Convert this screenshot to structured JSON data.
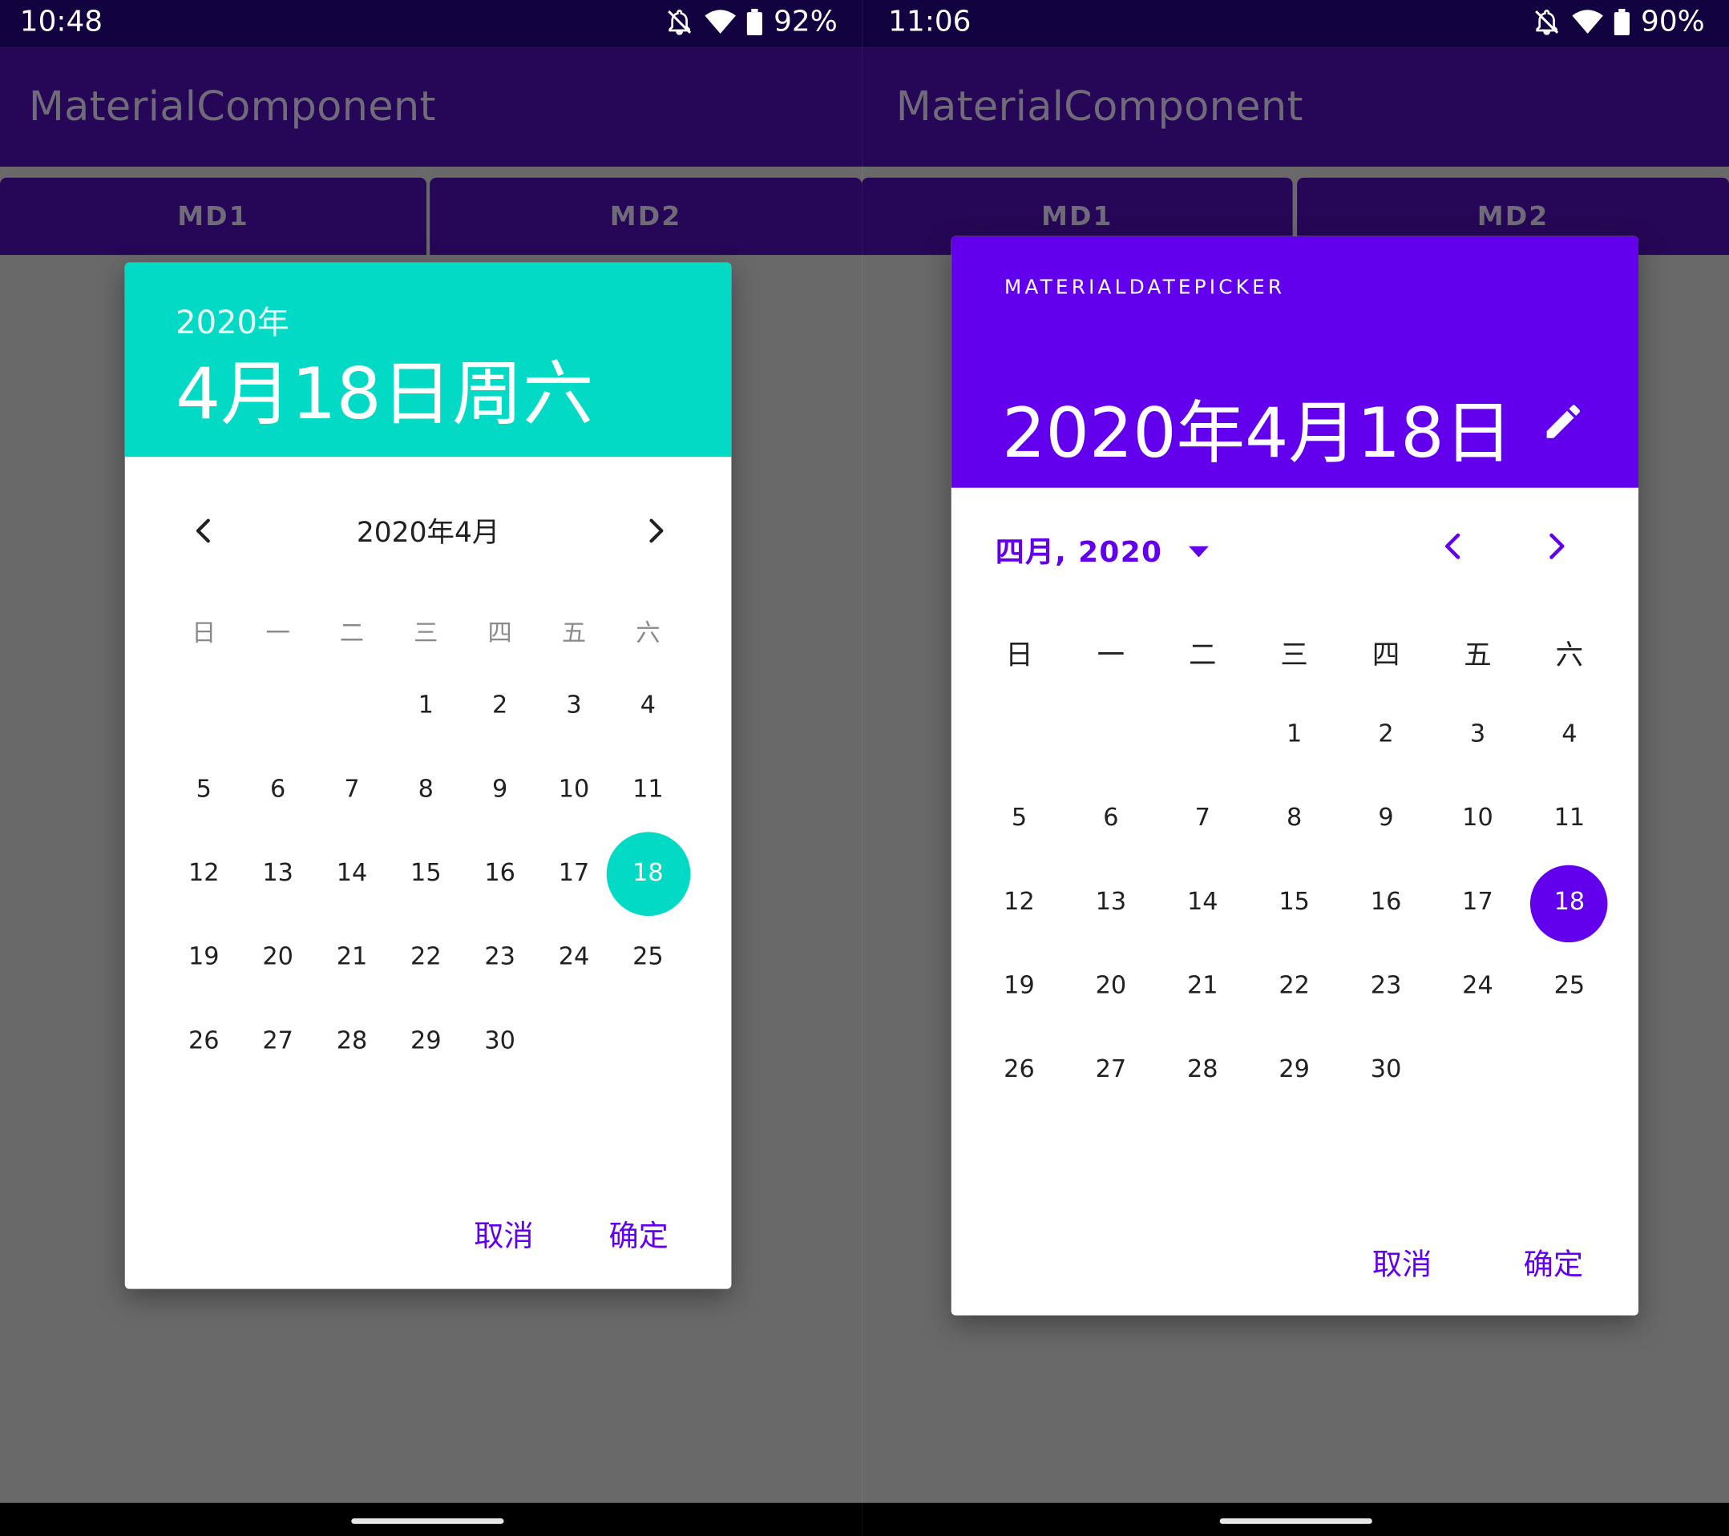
{
  "left": {
    "status": {
      "time": "10:48",
      "battery": "92%"
    },
    "app_title": "MaterialComponent",
    "tabs": [
      "MD1",
      "MD2"
    ],
    "dialog": {
      "header_year": "2020年",
      "header_date": "4月18日周六",
      "month_title": "2020年4月",
      "weekdays": [
        "日",
        "一",
        "二",
        "三",
        "四",
        "五",
        "六"
      ],
      "days": [
        "1",
        "2",
        "3",
        "4",
        "5",
        "6",
        "7",
        "8",
        "9",
        "10",
        "11",
        "12",
        "13",
        "14",
        "15",
        "16",
        "17",
        "18",
        "19",
        "20",
        "21",
        "22",
        "23",
        "24",
        "25",
        "26",
        "27",
        "28",
        "29",
        "30"
      ],
      "first_weekday_index": 3,
      "selected_day": "18",
      "cancel": "取消",
      "ok": "确定",
      "accent": "#03dac5"
    }
  },
  "right": {
    "status": {
      "time": "11:06",
      "battery": "90%"
    },
    "app_title": "MaterialComponent",
    "tabs": [
      "MD1",
      "MD2"
    ],
    "dialog": {
      "label": "MATERIALDATEPICKER",
      "header_date": "2020年4月18日",
      "month_selector": "四月, 2020",
      "weekdays": [
        "日",
        "一",
        "二",
        "三",
        "四",
        "五",
        "六"
      ],
      "days": [
        "1",
        "2",
        "3",
        "4",
        "5",
        "6",
        "7",
        "8",
        "9",
        "10",
        "11",
        "12",
        "13",
        "14",
        "15",
        "16",
        "17",
        "18",
        "19",
        "20",
        "21",
        "22",
        "23",
        "24",
        "25",
        "26",
        "27",
        "28",
        "29",
        "30"
      ],
      "first_weekday_index": 3,
      "selected_day": "18",
      "cancel": "取消",
      "ok": "确定",
      "accent": "#6200ee"
    }
  }
}
